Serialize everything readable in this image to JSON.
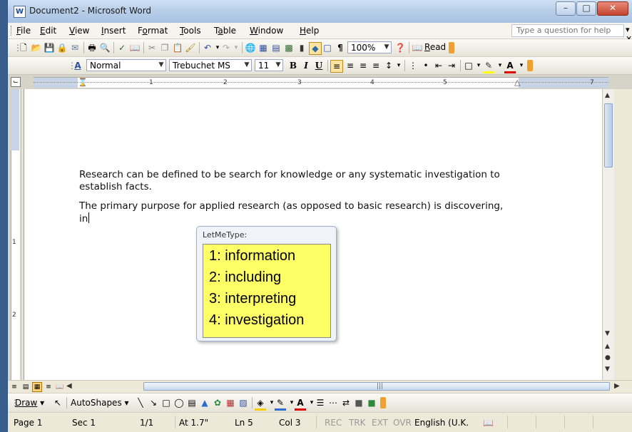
{
  "window": {
    "title": "Document2 - Microsoft Word",
    "icon": "word-doc-icon",
    "controls": [
      "minimize",
      "maximize",
      "close"
    ]
  },
  "menubar": {
    "items": [
      "File",
      "Edit",
      "View",
      "Insert",
      "Format",
      "Tools",
      "Table",
      "Window",
      "Help"
    ],
    "mnemonics": [
      "F",
      "E",
      "V",
      "I",
      "o",
      "T",
      "a",
      "W",
      "H"
    ],
    "help_placeholder": "Type a question for help"
  },
  "standard_toolbar": {
    "zoom": "100%",
    "read_label": "Read"
  },
  "formatting_toolbar": {
    "style": "Normal",
    "font": "Trebuchet MS",
    "size": "11"
  },
  "ruler": {
    "numbers": [
      "1",
      "2",
      "3",
      "4",
      "5",
      "7"
    ]
  },
  "vertical_ruler": {
    "numbers": [
      "1",
      "2"
    ]
  },
  "document": {
    "paragraph1_line1": "Research can be defined to be search for knowledge or any systematic investigation to",
    "paragraph1_line2": "establish facts.",
    "paragraph2_line1": "The primary purpose for applied research (as opposed to basic research) is discovering,",
    "paragraph2_line2": "in"
  },
  "autocomplete": {
    "title": "LetMeType:",
    "suggestions": [
      "1: information",
      "2: including",
      "3: interpreting",
      "4: investigation"
    ]
  },
  "drawing_toolbar": {
    "draw_label": "Draw",
    "autoshapes_label": "AutoShapes"
  },
  "statusbar": {
    "page": "Page 1",
    "section": "Sec 1",
    "pages": "1/1",
    "at": "At 1.7\"",
    "line": "Ln 5",
    "col": "Col 3",
    "rec": "REC",
    "trk": "TRK",
    "ext": "EXT",
    "ovr": "OVR",
    "language": "English (U.K."
  }
}
